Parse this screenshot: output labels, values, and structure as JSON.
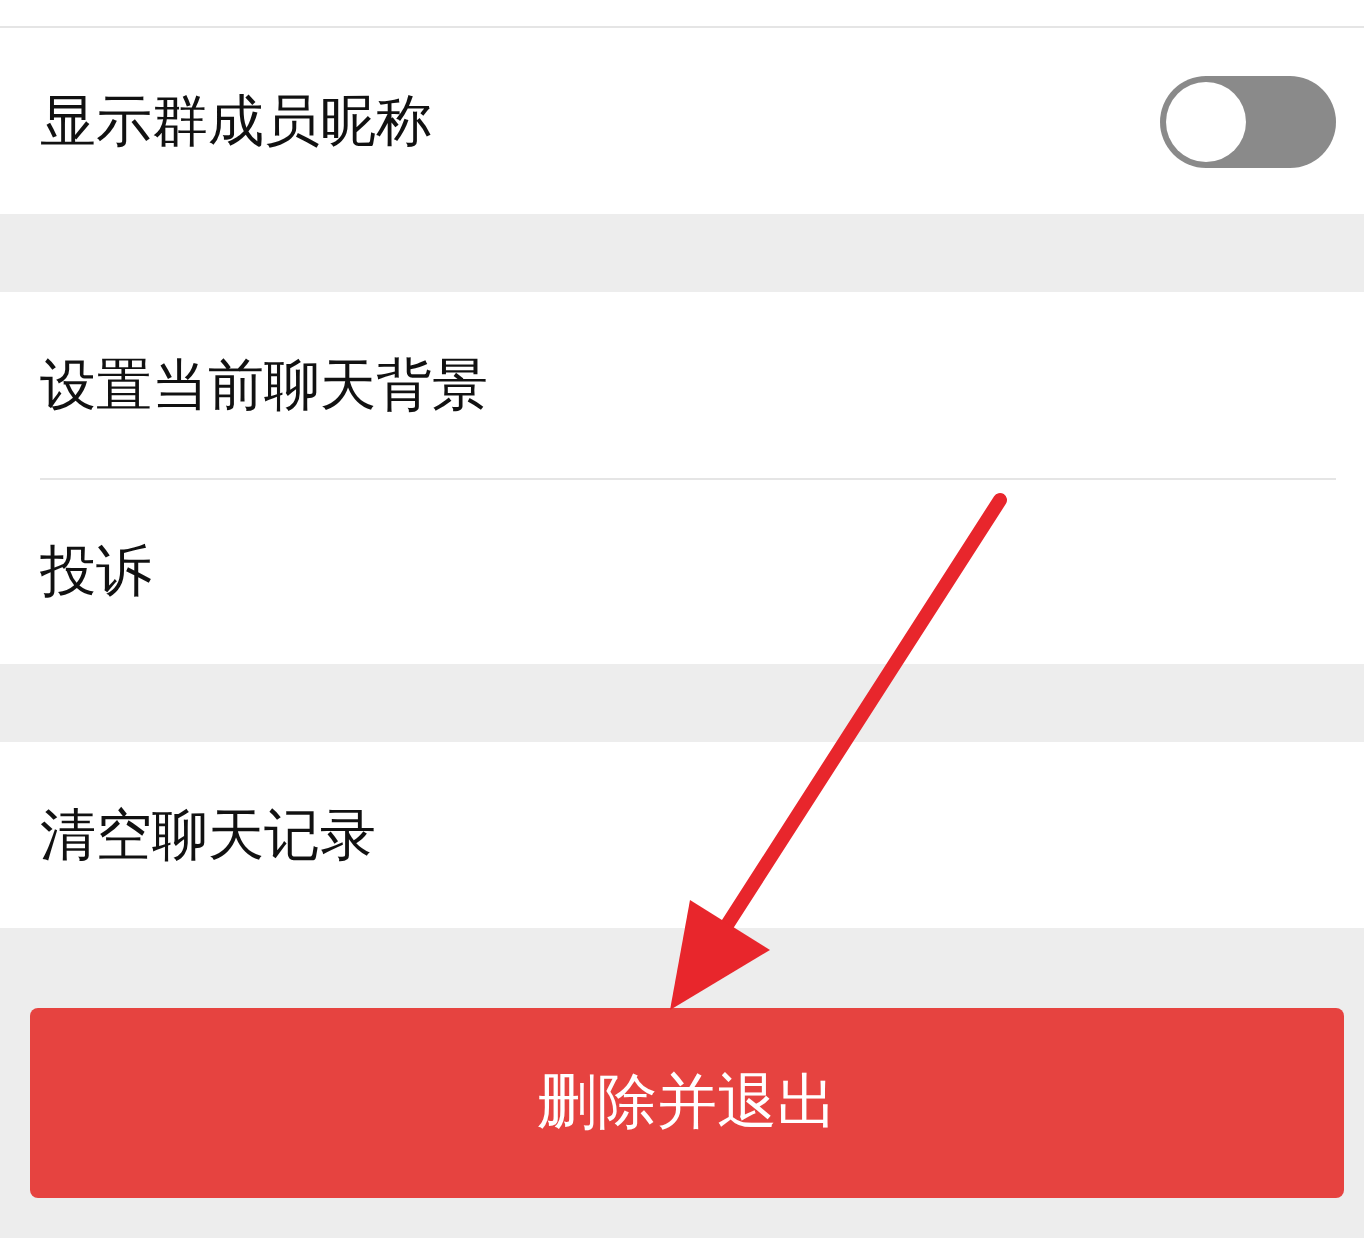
{
  "sections": [
    {
      "rows": [
        {
          "kind": "toggle",
          "label": "显示群成员昵称",
          "on": false
        }
      ]
    },
    {
      "rows": [
        {
          "kind": "plain",
          "label": "设置当前聊天背景"
        },
        {
          "kind": "plain",
          "label": "投诉"
        }
      ]
    },
    {
      "rows": [
        {
          "kind": "plain",
          "label": "清空聊天记录"
        }
      ]
    }
  ],
  "danger_button": {
    "label": "删除并退出"
  }
}
